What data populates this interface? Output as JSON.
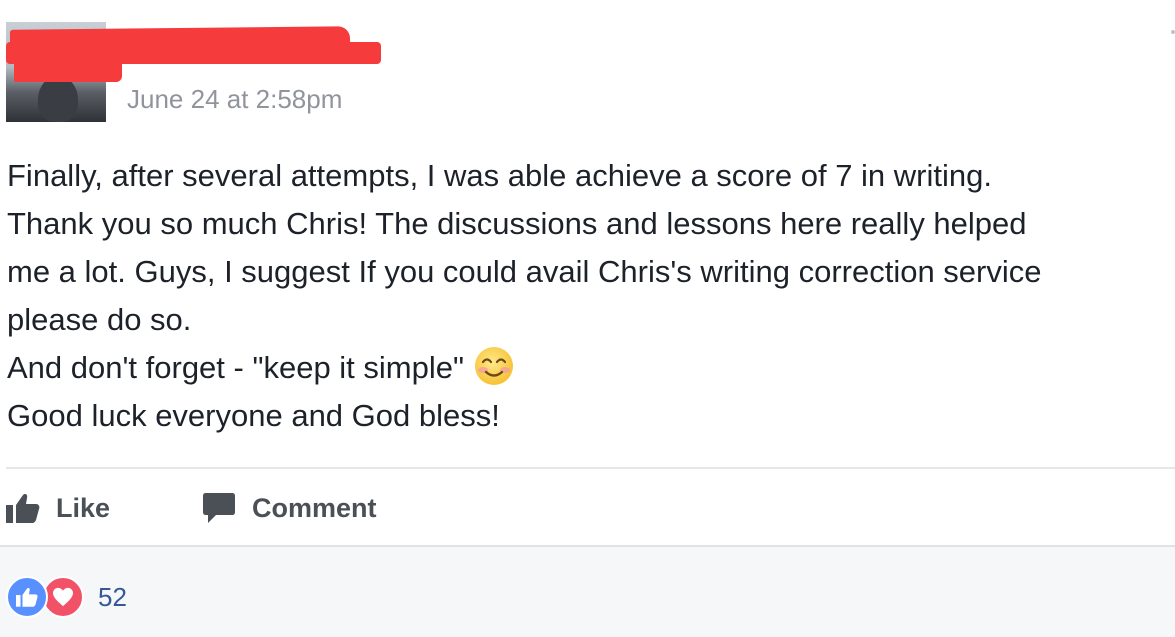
{
  "post": {
    "timestamp": "June 24 at 2:58pm",
    "lines": [
      "Finally, after several attempts, I was able achieve a score of 7 in writing.",
      "Thank you so much Chris! The discussions and lessons here really helped",
      "me a lot. Guys, I suggest If you could avail Chris's writing correction service",
      "please do so.",
      "And don't forget - \"keep it simple\"",
      "Good luck everyone and God bless!"
    ],
    "emoji": "smiling-face-icon"
  },
  "actions": {
    "like_label": "Like",
    "comment_label": "Comment"
  },
  "reactions": {
    "count": "52",
    "types": [
      "like",
      "love"
    ]
  },
  "colors": {
    "like_blue": "#5890ff",
    "love_red": "#f25268",
    "link_blue": "#365899",
    "muted_gray": "#90949c"
  }
}
